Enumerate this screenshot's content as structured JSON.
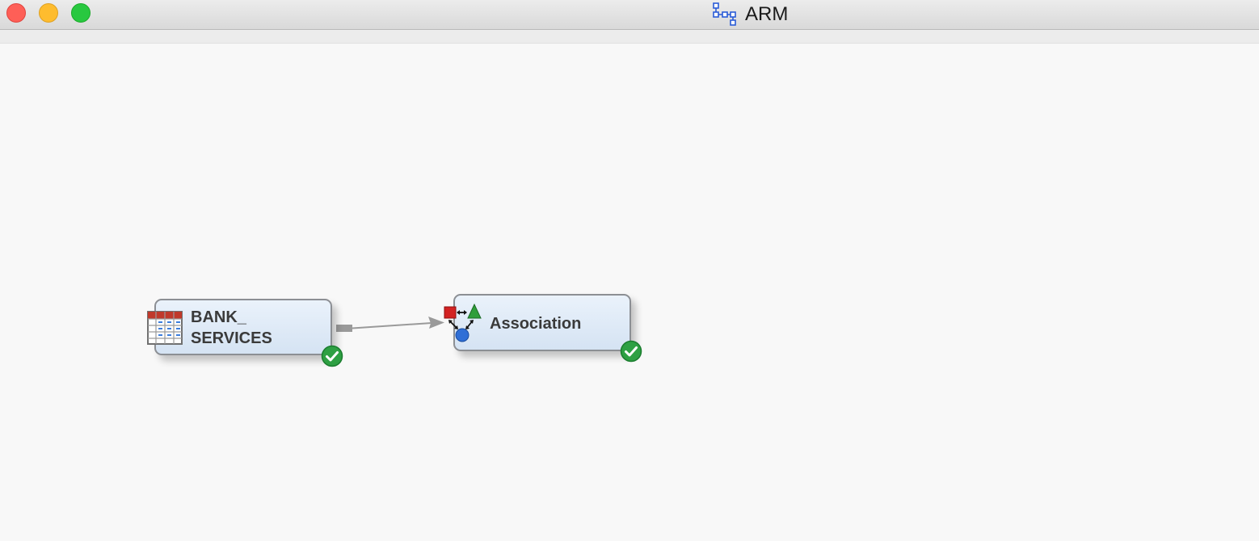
{
  "window": {
    "title": "ARM",
    "title_icon": "process-flow-diagram-icon"
  },
  "diagram": {
    "nodes": [
      {
        "label_line1": "BANK_",
        "label_line2": "SERVICES",
        "icon": "data-table-icon",
        "status": "completed"
      },
      {
        "label": "Association",
        "icon": "association-node-icon",
        "status": "completed"
      }
    ],
    "connections": [
      {
        "from": "BANK_SERVICES",
        "to": "Association"
      }
    ]
  },
  "colors": {
    "node_fill_top": "#eaf2fb",
    "node_fill_bottom": "#d5e3f3",
    "node_border": "#8c8f94",
    "status_ok": "#2ea043",
    "arrow": "#9a9a9a"
  }
}
